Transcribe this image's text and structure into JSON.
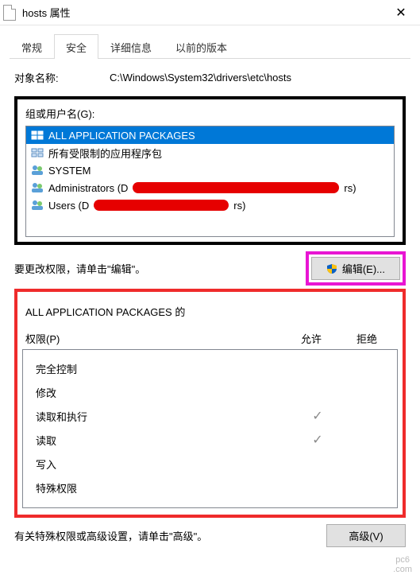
{
  "window": {
    "title": "hosts 属性"
  },
  "tabs": {
    "general": "常规",
    "security": "安全",
    "details": "详细信息",
    "previous": "以前的版本"
  },
  "object": {
    "label": "对象名称:",
    "path": "C:\\Windows\\System32\\drivers\\etc\\hosts"
  },
  "groups": {
    "label": "组或用户名(G):",
    "items": [
      {
        "name": "ALL APPLICATION PACKAGES",
        "icon": "pkg",
        "selected": true
      },
      {
        "name": "所有受限制的应用程序包",
        "icon": "pkg"
      },
      {
        "name": "SYSTEM",
        "icon": "users"
      },
      {
        "name_prefix": "Administrators (D",
        "name_suffix": "rs)",
        "icon": "users",
        "redacted": true
      },
      {
        "name_prefix": "Users (D",
        "name_suffix": "rs)",
        "icon": "users",
        "redacted": true
      }
    ]
  },
  "edit": {
    "hint": "要更改权限，请单击\"编辑\"。",
    "button": "编辑(E)..."
  },
  "permissions": {
    "header_name_line1": "ALL APPLICATION PACKAGES 的",
    "header_name_line2": "权限(P)",
    "col_allow": "允许",
    "col_deny": "拒绝",
    "rows": [
      {
        "label": "完全控制",
        "allow": false,
        "deny": false
      },
      {
        "label": "修改",
        "allow": false,
        "deny": false
      },
      {
        "label": "读取和执行",
        "allow": true,
        "deny": false
      },
      {
        "label": "读取",
        "allow": true,
        "deny": false
      },
      {
        "label": "写入",
        "allow": false,
        "deny": false
      },
      {
        "label": "特殊权限",
        "allow": false,
        "deny": false
      }
    ]
  },
  "advanced": {
    "hint": "有关特殊权限或高级设置，请单击\"高级\"。",
    "button": "高级(V)"
  },
  "watermark": {
    "l1": "pc6",
    "l2": ".com"
  }
}
